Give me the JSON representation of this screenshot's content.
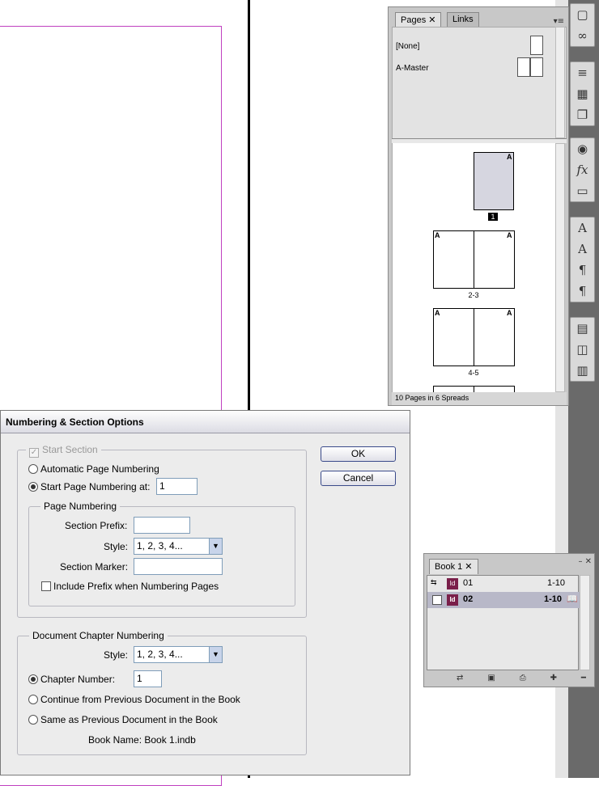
{
  "pages_panel": {
    "tabs": [
      "Pages",
      "Links"
    ],
    "masters": [
      "[None]",
      "A-Master"
    ],
    "spreads": [
      {
        "label": "1",
        "prefix": "A"
      },
      {
        "label": "2-3",
        "prefix": "A"
      },
      {
        "label": "4-5",
        "prefix": "A"
      }
    ],
    "status": "10 Pages in 6 Spreads"
  },
  "toolbar": {
    "icons": [
      "pages-icon",
      "links-icon",
      "stroke-icon",
      "swatches-grid-icon",
      "layers-icon",
      "color-icon",
      "fx-icon",
      "gradient-icon",
      "character-icon",
      "character-styles-icon",
      "paragraph-icon",
      "paragraph-styles-icon",
      "text-wrap-icon",
      "object-styles-icon",
      "table-icon"
    ]
  },
  "dialog": {
    "title": "Numbering & Section Options",
    "start_section": "Start Section",
    "auto_numbering": "Automatic Page Numbering",
    "start_numbering_at": "Start Page Numbering at:",
    "start_value": "1",
    "page_numbering_legend": "Page Numbering",
    "section_prefix_label": "Section Prefix:",
    "section_prefix_value": "",
    "style_label": "Style:",
    "style_value": "1, 2, 3, 4...",
    "section_marker_label": "Section Marker:",
    "section_marker_value": "",
    "include_prefix": "Include Prefix when Numbering Pages",
    "chapter_legend": "Document Chapter Numbering",
    "chapter_style_label": "Style:",
    "chapter_style_value": "1, 2, 3, 4...",
    "chapter_number_label": "Chapter Number:",
    "chapter_number_value": "1",
    "continue_previous": "Continue from Previous Document in the Book",
    "same_previous": "Same as Previous Document in the Book",
    "book_name": "Book Name: Book 1.indb",
    "ok": "OK",
    "cancel": "Cancel"
  },
  "book_panel": {
    "tab": "Book 1",
    "rows": [
      {
        "name": "01",
        "pages": "1-10"
      },
      {
        "name": "02",
        "pages": "1-10"
      }
    ]
  }
}
